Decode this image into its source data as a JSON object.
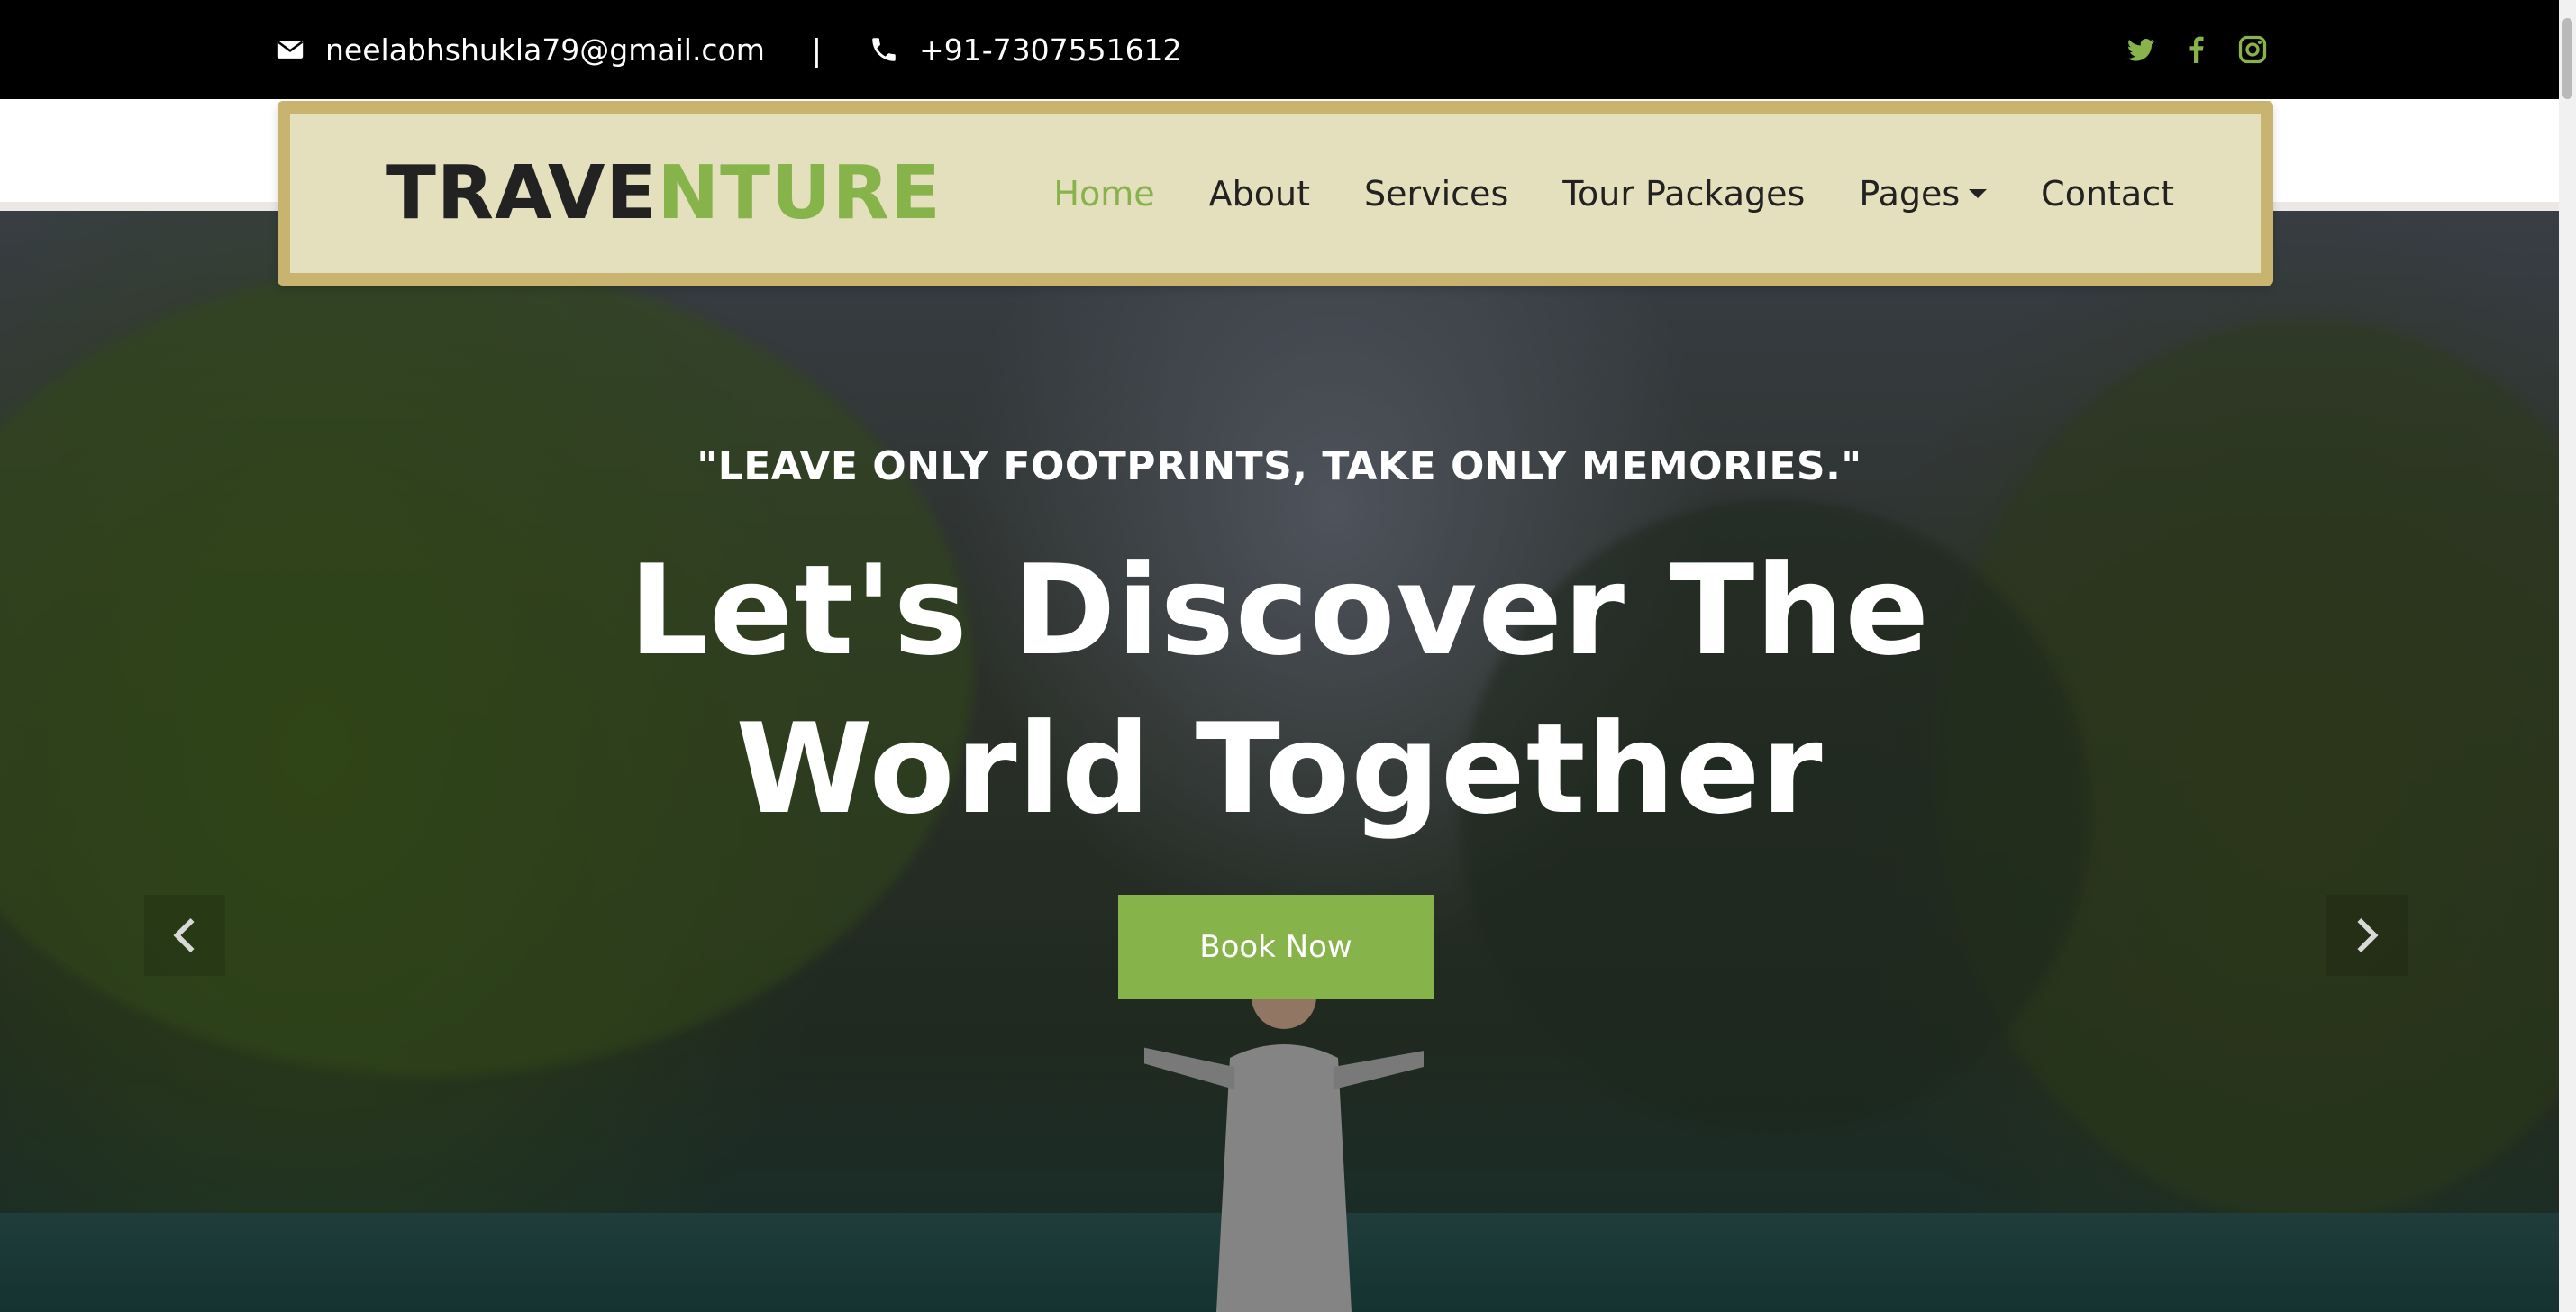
{
  "topbar": {
    "email": "neelabhshukla79@gmail.com",
    "separator": "|",
    "phone": "+91-7307551612",
    "social": [
      "twitter-icon",
      "facebook-icon",
      "instagram-icon"
    ],
    "accent": "#86b34a"
  },
  "brand": {
    "part1": "TRAVE",
    "part2": "NTURE"
  },
  "nav": {
    "home": "Home",
    "about": "About",
    "services": "Services",
    "tour_packages": "Tour Packages",
    "pages": "Pages",
    "contact": "Contact",
    "active": "Home"
  },
  "hero": {
    "tagline": "\"LEAVE ONLY FOOTPRINTS, TAKE ONLY MEMORIES.\"",
    "headline_line1": "Let's Discover The",
    "headline_line2": "World Together",
    "button": "Book Now",
    "prev_icon": "chevron-left-icon",
    "next_icon": "chevron-right-icon"
  },
  "colors": {
    "accent": "#86b34a",
    "navbar_bg": "#e4dfbc",
    "navbar_border": "#c8b46e",
    "topbar_bg": "#000000"
  }
}
